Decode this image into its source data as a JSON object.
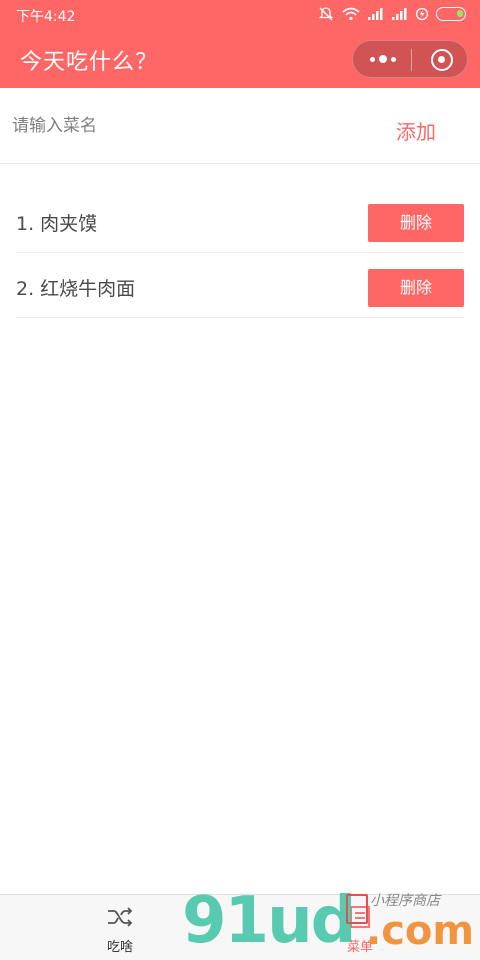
{
  "status_bar": {
    "time": "下午4:42"
  },
  "nav": {
    "title": "今天吃什么？"
  },
  "input": {
    "placeholder": "请输入菜名",
    "value": ""
  },
  "add_button": {
    "label": "添加"
  },
  "dishes": [
    {
      "label": "1. 肉夹馍",
      "delete_label": "删除"
    },
    {
      "label": "2. 红烧牛肉面",
      "delete_label": "删除"
    }
  ],
  "tabbar": {
    "items": [
      {
        "label": "吃啥",
        "icon": "shuffle-icon"
      },
      {
        "label": "菜单",
        "icon": "menu-icon"
      }
    ]
  },
  "watermark": {
    "text": "91ud",
    "domain": ".com",
    "tagline": "小程序商店"
  },
  "colors": {
    "accent": "#ff6666",
    "tab_active": "#ff6666"
  }
}
